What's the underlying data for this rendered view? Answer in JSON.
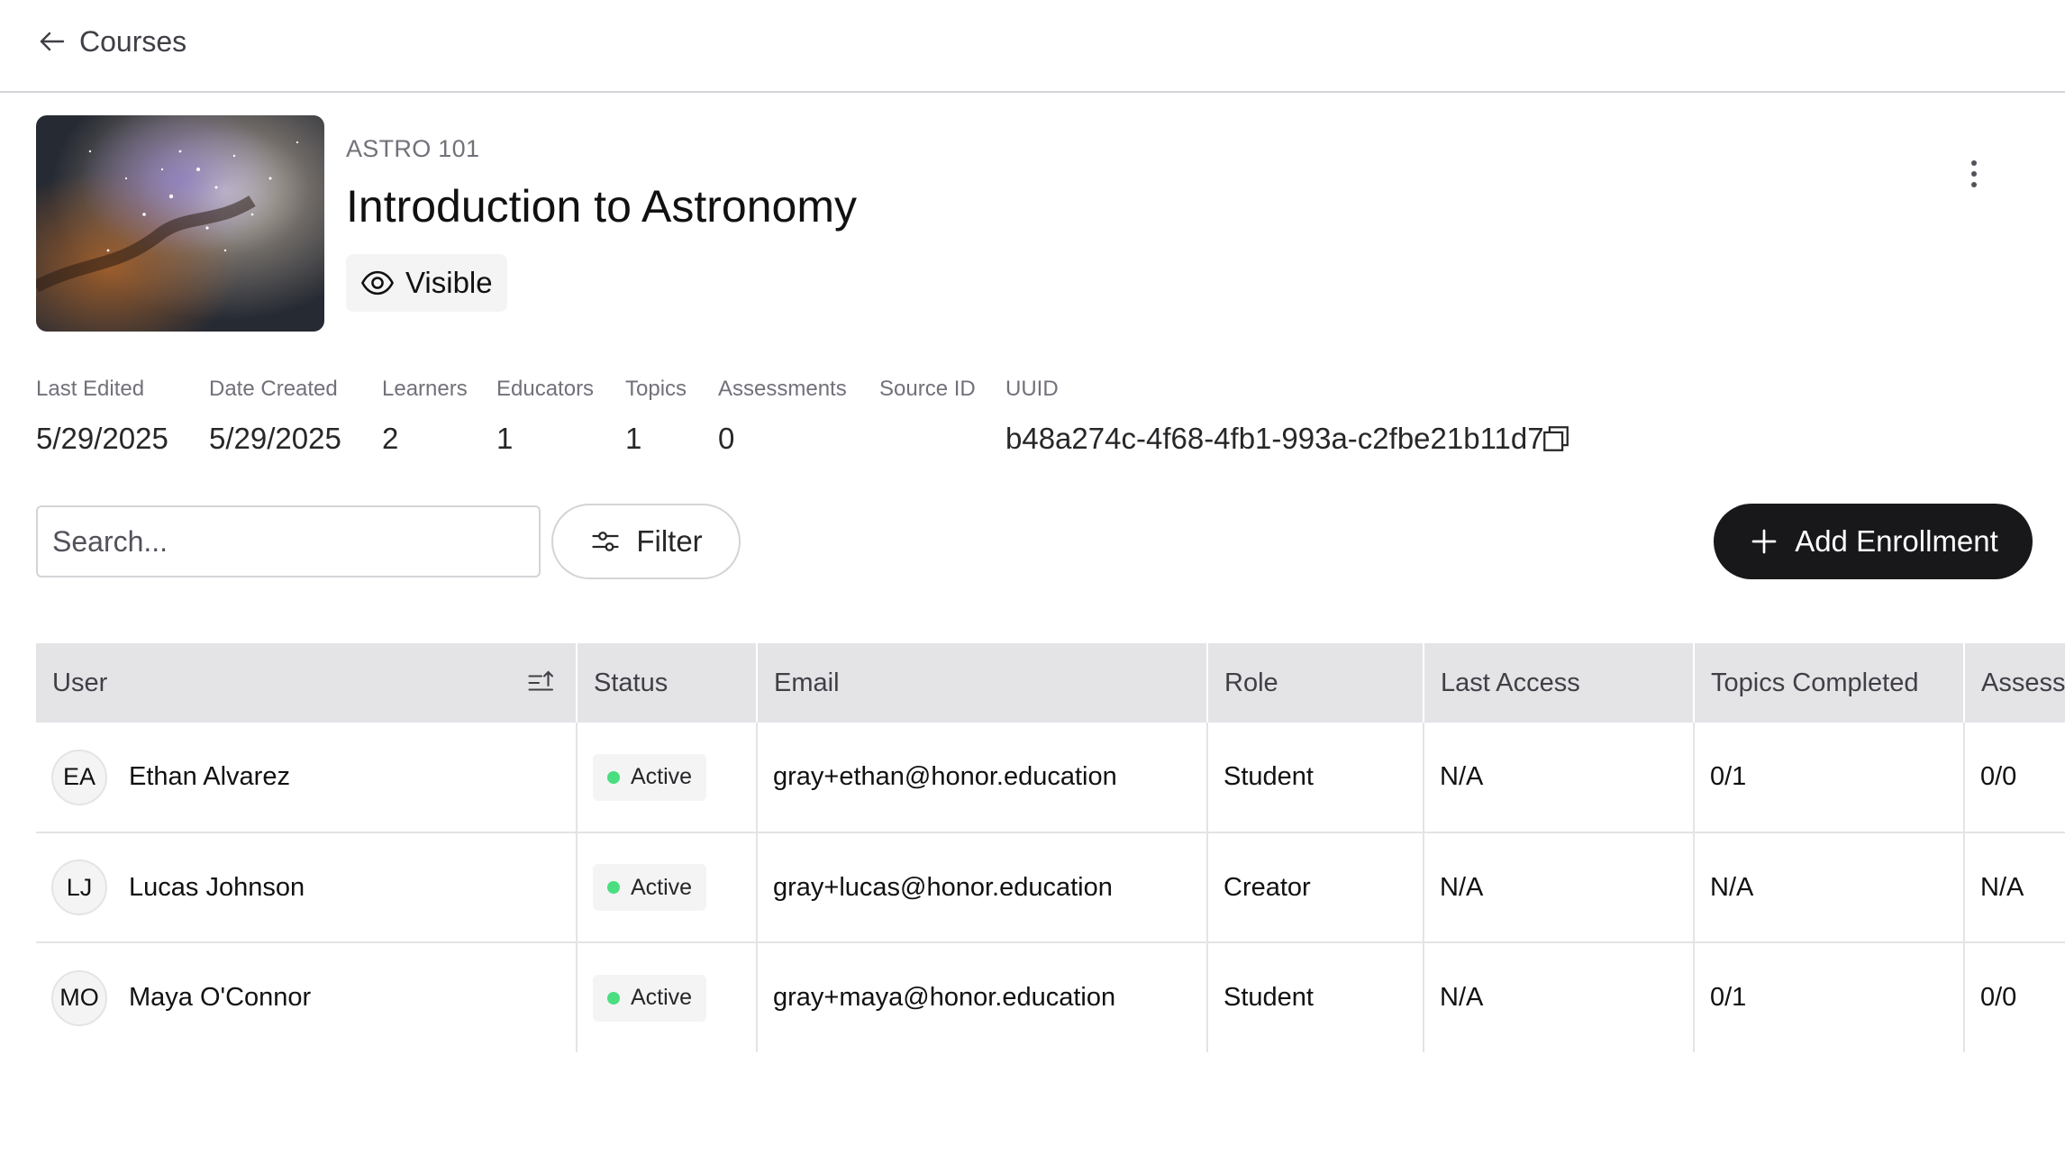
{
  "nav": {
    "back_label": "Courses"
  },
  "course": {
    "code": "ASTRO 101",
    "title": "Introduction to Astronomy",
    "visibility": "Visible"
  },
  "meta": {
    "last_edited": {
      "label": "Last Edited",
      "value": "5/29/2025"
    },
    "date_created": {
      "label": "Date Created",
      "value": "5/29/2025"
    },
    "learners": {
      "label": "Learners",
      "value": "2"
    },
    "educators": {
      "label": "Educators",
      "value": "1"
    },
    "topics": {
      "label": "Topics",
      "value": "1"
    },
    "assessments": {
      "label": "Assessments",
      "value": "0"
    },
    "source_id": {
      "label": "Source ID",
      "value": ""
    },
    "uuid": {
      "label": "UUID",
      "value": "b48a274c-4f68-4fb1-993a-c2fbe21b11d7"
    }
  },
  "toolbar": {
    "search_placeholder": "Search...",
    "filter_label": "Filter",
    "add_label": "Add Enrollment"
  },
  "table": {
    "headers": {
      "user": "User",
      "status": "Status",
      "email": "Email",
      "role": "Role",
      "last_access": "Last Access",
      "topics_completed": "Topics Completed",
      "assessments": "Assessments"
    },
    "rows": [
      {
        "initials": "EA",
        "name": "Ethan Alvarez",
        "status": "Active",
        "email": "gray+ethan@honor.education",
        "role": "Student",
        "last_access": "N/A",
        "topics_completed": "0/1",
        "assessments": "0/0"
      },
      {
        "initials": "LJ",
        "name": "Lucas Johnson",
        "status": "Active",
        "email": "gray+lucas@honor.education",
        "role": "Creator",
        "last_access": "N/A",
        "topics_completed": "N/A",
        "assessments": "N/A"
      },
      {
        "initials": "MO",
        "name": "Maya O'Connor",
        "status": "Active",
        "email": "gray+maya@honor.education",
        "role": "Student",
        "last_access": "N/A",
        "topics_completed": "0/1",
        "assessments": "0/0"
      }
    ]
  },
  "colors": {
    "primary_button": "#18181b",
    "status_active": "#4ade80",
    "header_bg": "#e4e4e7"
  },
  "icons": {
    "back": "arrow-left-icon",
    "visibility": "eye-icon",
    "menu": "more-vertical-icon",
    "copy": "copy-icon",
    "filter": "sliders-icon",
    "add": "plus-icon",
    "sort": "sort-ascending-icon"
  }
}
